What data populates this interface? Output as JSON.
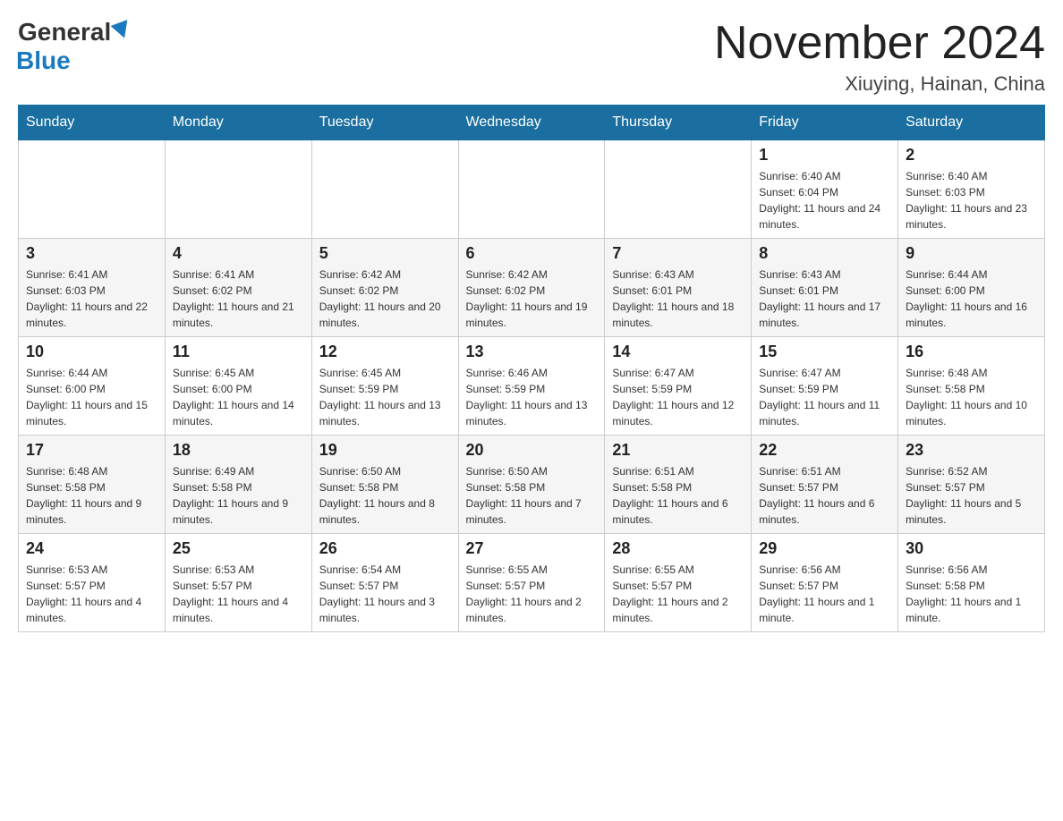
{
  "header": {
    "month_year": "November 2024",
    "location": "Xiuying, Hainan, China",
    "logo_general": "General",
    "logo_blue": "Blue"
  },
  "weekdays": [
    "Sunday",
    "Monday",
    "Tuesday",
    "Wednesday",
    "Thursday",
    "Friday",
    "Saturday"
  ],
  "weeks": [
    [
      {
        "day": "",
        "info": ""
      },
      {
        "day": "",
        "info": ""
      },
      {
        "day": "",
        "info": ""
      },
      {
        "day": "",
        "info": ""
      },
      {
        "day": "",
        "info": ""
      },
      {
        "day": "1",
        "info": "Sunrise: 6:40 AM\nSunset: 6:04 PM\nDaylight: 11 hours and 24 minutes."
      },
      {
        "day": "2",
        "info": "Sunrise: 6:40 AM\nSunset: 6:03 PM\nDaylight: 11 hours and 23 minutes."
      }
    ],
    [
      {
        "day": "3",
        "info": "Sunrise: 6:41 AM\nSunset: 6:03 PM\nDaylight: 11 hours and 22 minutes."
      },
      {
        "day": "4",
        "info": "Sunrise: 6:41 AM\nSunset: 6:02 PM\nDaylight: 11 hours and 21 minutes."
      },
      {
        "day": "5",
        "info": "Sunrise: 6:42 AM\nSunset: 6:02 PM\nDaylight: 11 hours and 20 minutes."
      },
      {
        "day": "6",
        "info": "Sunrise: 6:42 AM\nSunset: 6:02 PM\nDaylight: 11 hours and 19 minutes."
      },
      {
        "day": "7",
        "info": "Sunrise: 6:43 AM\nSunset: 6:01 PM\nDaylight: 11 hours and 18 minutes."
      },
      {
        "day": "8",
        "info": "Sunrise: 6:43 AM\nSunset: 6:01 PM\nDaylight: 11 hours and 17 minutes."
      },
      {
        "day": "9",
        "info": "Sunrise: 6:44 AM\nSunset: 6:00 PM\nDaylight: 11 hours and 16 minutes."
      }
    ],
    [
      {
        "day": "10",
        "info": "Sunrise: 6:44 AM\nSunset: 6:00 PM\nDaylight: 11 hours and 15 minutes."
      },
      {
        "day": "11",
        "info": "Sunrise: 6:45 AM\nSunset: 6:00 PM\nDaylight: 11 hours and 14 minutes."
      },
      {
        "day": "12",
        "info": "Sunrise: 6:45 AM\nSunset: 5:59 PM\nDaylight: 11 hours and 13 minutes."
      },
      {
        "day": "13",
        "info": "Sunrise: 6:46 AM\nSunset: 5:59 PM\nDaylight: 11 hours and 13 minutes."
      },
      {
        "day": "14",
        "info": "Sunrise: 6:47 AM\nSunset: 5:59 PM\nDaylight: 11 hours and 12 minutes."
      },
      {
        "day": "15",
        "info": "Sunrise: 6:47 AM\nSunset: 5:59 PM\nDaylight: 11 hours and 11 minutes."
      },
      {
        "day": "16",
        "info": "Sunrise: 6:48 AM\nSunset: 5:58 PM\nDaylight: 11 hours and 10 minutes."
      }
    ],
    [
      {
        "day": "17",
        "info": "Sunrise: 6:48 AM\nSunset: 5:58 PM\nDaylight: 11 hours and 9 minutes."
      },
      {
        "day": "18",
        "info": "Sunrise: 6:49 AM\nSunset: 5:58 PM\nDaylight: 11 hours and 9 minutes."
      },
      {
        "day": "19",
        "info": "Sunrise: 6:50 AM\nSunset: 5:58 PM\nDaylight: 11 hours and 8 minutes."
      },
      {
        "day": "20",
        "info": "Sunrise: 6:50 AM\nSunset: 5:58 PM\nDaylight: 11 hours and 7 minutes."
      },
      {
        "day": "21",
        "info": "Sunrise: 6:51 AM\nSunset: 5:58 PM\nDaylight: 11 hours and 6 minutes."
      },
      {
        "day": "22",
        "info": "Sunrise: 6:51 AM\nSunset: 5:57 PM\nDaylight: 11 hours and 6 minutes."
      },
      {
        "day": "23",
        "info": "Sunrise: 6:52 AM\nSunset: 5:57 PM\nDaylight: 11 hours and 5 minutes."
      }
    ],
    [
      {
        "day": "24",
        "info": "Sunrise: 6:53 AM\nSunset: 5:57 PM\nDaylight: 11 hours and 4 minutes."
      },
      {
        "day": "25",
        "info": "Sunrise: 6:53 AM\nSunset: 5:57 PM\nDaylight: 11 hours and 4 minutes."
      },
      {
        "day": "26",
        "info": "Sunrise: 6:54 AM\nSunset: 5:57 PM\nDaylight: 11 hours and 3 minutes."
      },
      {
        "day": "27",
        "info": "Sunrise: 6:55 AM\nSunset: 5:57 PM\nDaylight: 11 hours and 2 minutes."
      },
      {
        "day": "28",
        "info": "Sunrise: 6:55 AM\nSunset: 5:57 PM\nDaylight: 11 hours and 2 minutes."
      },
      {
        "day": "29",
        "info": "Sunrise: 6:56 AM\nSunset: 5:57 PM\nDaylight: 11 hours and 1 minute."
      },
      {
        "day": "30",
        "info": "Sunrise: 6:56 AM\nSunset: 5:58 PM\nDaylight: 11 hours and 1 minute."
      }
    ]
  ]
}
